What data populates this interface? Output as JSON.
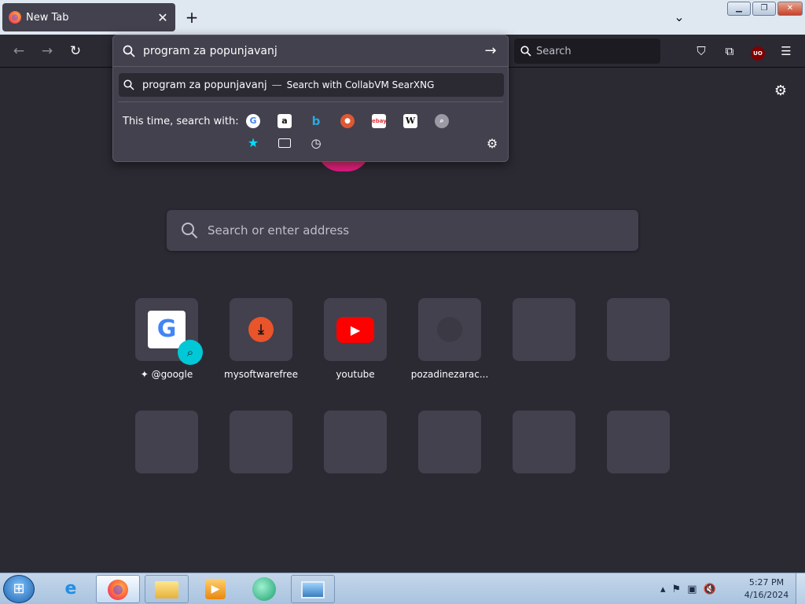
{
  "tab": {
    "title": "New Tab",
    "close": "✕"
  },
  "tabstrip": {
    "new_tab": "+",
    "list_all": "⌄"
  },
  "window": {
    "minimize": "▁",
    "restore": "❐",
    "close": "✕"
  },
  "nav": {
    "back": "←",
    "forward": "→",
    "reload": "↻"
  },
  "searchbar": {
    "placeholder": "Search"
  },
  "toolbar": {
    "pocket": "⛉",
    "extensions": "⧉",
    "ublock": "UO",
    "menu": "☰"
  },
  "urlbar": {
    "value": "program za popunjavanj",
    "go": "→",
    "suggestion": {
      "query": "program za popunjavanj",
      "separator": "—",
      "action": "Search with CollabVM SearXNG"
    },
    "search_with_label": "This time, search with:",
    "engines": [
      "google-icon",
      "amazon-icon",
      "bing-icon",
      "duckduckgo-icon",
      "ebay-icon",
      "wikipedia-icon",
      "searxng-icon",
      "bookmarks-star-icon",
      "tabs-icon",
      "history-clock-icon"
    ],
    "settings": "⚙"
  },
  "newtab": {
    "settings": "⚙",
    "search_placeholder": "Search or enter address",
    "top_sites": [
      {
        "label": "@google"
      },
      {
        "label": "mysoftwarefree"
      },
      {
        "label": "youtube"
      },
      {
        "label": "pozadinezarac..."
      }
    ]
  },
  "taskbar": {
    "clock_time": "5:27 PM",
    "clock_date": "4/16/2024"
  },
  "colors": {
    "bg": "#2b2a33",
    "panel": "#42414d",
    "accent": "#00c8d7"
  }
}
